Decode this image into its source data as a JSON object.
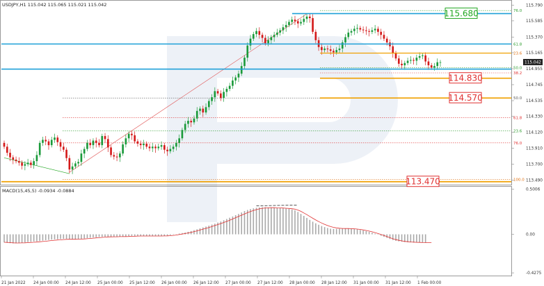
{
  "chart_data": [
    {
      "type": "candlestick",
      "header": "USDJPY,H1  115.042 115.065 115.021 115.042",
      "yticks": [
        "115.790",
        "115.585",
        "115.370",
        "115.165",
        "114.955",
        "114.745",
        "114.535",
        "114.330",
        "114.120",
        "113.910",
        "113.700",
        "113.490"
      ],
      "ytick_values": [
        115.79,
        115.585,
        115.37,
        115.165,
        114.955,
        114.745,
        114.535,
        114.33,
        114.12,
        113.91,
        113.7,
        113.49
      ],
      "ylim": [
        113.44,
        115.84
      ],
      "current_price": "115.042",
      "current_price_value": 115.042,
      "price_labels": [
        {
          "text": "115.680",
          "value": 115.68,
          "color": "#22a722"
        },
        {
          "text": "114.830",
          "value": 114.83,
          "color": "#e03030"
        },
        {
          "text": "114.570",
          "value": 114.57,
          "color": "#e03030"
        },
        {
          "text": "113.470",
          "value": 113.47,
          "color": "#e03030"
        }
      ],
      "fib_levels": [
        {
          "text": "76.0",
          "value": 115.72,
          "color": "#2d9c2d"
        },
        {
          "text": "61.8",
          "value": 115.28,
          "color": "#2d9c2d"
        },
        {
          "text": "23.6",
          "value": 115.16,
          "color": "#e07010"
        },
        {
          "text": "50.0",
          "value": 114.97,
          "color": "#2d9c2d"
        },
        {
          "text": "38.2",
          "value": 114.9,
          "color": "#e03030"
        },
        {
          "text": "50.0",
          "value": 114.57,
          "color": "#555555"
        },
        {
          "text": "61.8",
          "value": 114.31,
          "color": "#e03030"
        },
        {
          "text": "23.6",
          "value": 114.14,
          "color": "#2d9c2d"
        },
        {
          "text": "76.0",
          "value": 113.98,
          "color": "#e03030"
        },
        {
          "text": "100.0",
          "value": 113.5,
          "color": "#e07010"
        }
      ],
      "candles_close": [
        113.93,
        113.85,
        113.79,
        113.76,
        113.74,
        113.72,
        113.68,
        113.7,
        113.72,
        113.69,
        113.74,
        113.82,
        113.98,
        114.02,
        114.0,
        113.95,
        114.02,
        114.05,
        113.99,
        113.93,
        113.89,
        113.78,
        113.63,
        113.67,
        113.71,
        113.73,
        113.84,
        113.9,
        113.98,
        113.95,
        114.01,
        113.98,
        113.95,
        114.07,
        114.03,
        113.92,
        113.82,
        113.8,
        113.79,
        113.84,
        113.96,
        114.04,
        114.1,
        114.08,
        114.0,
        113.97,
        113.95,
        113.97,
        113.93,
        113.91,
        113.93,
        113.91,
        113.93,
        113.95,
        113.89,
        113.87,
        113.9,
        113.93,
        113.98,
        114.04,
        114.15,
        114.23,
        114.27,
        114.25,
        114.3,
        114.4,
        114.43,
        114.38,
        114.45,
        114.53,
        114.58,
        114.66,
        114.63,
        114.57,
        114.65,
        114.69,
        114.73,
        114.8,
        114.84,
        114.89,
        114.99,
        115.1,
        115.26,
        115.35,
        115.41,
        115.45,
        115.4,
        115.36,
        115.29,
        115.33,
        115.37,
        115.4,
        115.43,
        115.46,
        115.5,
        115.53,
        115.57,
        115.6,
        115.58,
        115.55,
        115.57,
        115.61,
        115.64,
        115.62,
        115.44,
        115.33,
        115.24,
        115.2,
        115.22,
        115.21,
        115.19,
        115.17,
        115.2,
        115.22,
        115.3,
        115.37,
        115.43,
        115.45,
        115.48,
        115.49,
        115.47,
        115.46,
        115.45,
        115.44,
        115.46,
        115.48,
        115.44,
        115.4,
        115.35,
        115.3,
        115.25,
        115.16,
        115.09,
        115.02,
        115.0,
        115.03,
        115.06,
        115.07,
        115.06,
        115.1,
        115.12,
        115.13,
        115.05,
        115.0,
        114.97,
        114.99,
        115.04,
        115.04
      ],
      "series": [
        {
          "name": "MACD(15,45,5) -0.0934",
          "values": [
            -0.09,
            -0.094,
            -0.098,
            -0.1,
            -0.1,
            -0.098,
            -0.094,
            -0.09,
            -0.086,
            -0.082,
            -0.08,
            -0.078,
            -0.074,
            -0.07,
            -0.066,
            -0.062,
            -0.058,
            -0.056,
            -0.054,
            -0.052,
            -0.05,
            -0.05,
            -0.052,
            -0.054,
            -0.054,
            -0.052,
            -0.05,
            -0.046,
            -0.042,
            -0.038,
            -0.035,
            -0.032,
            -0.03,
            -0.028,
            -0.026,
            -0.026,
            -0.026,
            -0.026,
            -0.026,
            -0.026,
            -0.024,
            -0.022,
            -0.02,
            -0.018,
            -0.018,
            -0.018,
            -0.018,
            -0.018,
            -0.018,
            -0.018,
            -0.018,
            -0.018,
            -0.018,
            -0.018,
            -0.016,
            -0.014,
            -0.01,
            -0.004,
            0.002,
            0.008,
            0.014,
            0.02,
            0.028,
            0.036,
            0.046,
            0.056,
            0.066,
            0.076,
            0.086,
            0.096,
            0.108,
            0.118,
            0.13,
            0.142,
            0.156,
            0.17,
            0.184,
            0.198,
            0.212,
            0.226,
            0.242,
            0.258,
            0.27,
            0.28,
            0.288,
            0.294,
            0.298,
            0.3,
            0.3,
            0.298,
            0.296,
            0.294,
            0.292,
            0.29,
            0.288,
            0.286,
            0.282,
            0.276,
            0.266,
            0.248,
            0.226,
            0.204,
            0.182,
            0.16,
            0.14,
            0.122,
            0.106,
            0.092,
            0.08,
            0.07,
            0.062,
            0.06,
            0.06,
            0.062,
            0.064,
            0.064,
            0.064,
            0.062,
            0.058,
            0.054,
            0.048,
            0.042,
            0.036,
            0.028,
            0.018,
            0.008,
            -0.004,
            -0.016,
            -0.028,
            -0.04,
            -0.052,
            -0.064,
            -0.072,
            -0.078,
            -0.082,
            -0.086,
            -0.088,
            -0.09,
            -0.092,
            -0.092,
            -0.092,
            -0.092,
            -0.093
          ]
        },
        {
          "name": "Signal -0.0884",
          "values": [
            -0.088,
            -0.09,
            -0.092,
            -0.094,
            -0.096,
            -0.096,
            -0.095,
            -0.094,
            -0.092,
            -0.09,
            -0.088,
            -0.086,
            -0.083,
            -0.08,
            -0.077,
            -0.073,
            -0.069,
            -0.066,
            -0.063,
            -0.061,
            -0.058,
            -0.056,
            -0.055,
            -0.055,
            -0.055,
            -0.054,
            -0.053,
            -0.051,
            -0.049,
            -0.046,
            -0.043,
            -0.04,
            -0.037,
            -0.034,
            -0.031,
            -0.029,
            -0.028,
            -0.027,
            -0.027,
            -0.026,
            -0.026,
            -0.025,
            -0.024,
            -0.022,
            -0.021,
            -0.02,
            -0.019,
            -0.019,
            -0.019,
            -0.019,
            -0.019,
            -0.019,
            -0.019,
            -0.019,
            -0.018,
            -0.017,
            -0.015,
            -0.012,
            -0.008,
            -0.003,
            0.003,
            0.009,
            0.015,
            0.022,
            0.03,
            0.038,
            0.047,
            0.057,
            0.066,
            0.076,
            0.086,
            0.097,
            0.108,
            0.119,
            0.131,
            0.143,
            0.156,
            0.17,
            0.184,
            0.198,
            0.212,
            0.226,
            0.24,
            0.253,
            0.264,
            0.274,
            0.282,
            0.288,
            0.292,
            0.294,
            0.295,
            0.295,
            0.294,
            0.293,
            0.291,
            0.289,
            0.287,
            0.284,
            0.279,
            0.269,
            0.255,
            0.237,
            0.218,
            0.198,
            0.178,
            0.159,
            0.141,
            0.125,
            0.11,
            0.097,
            0.086,
            0.077,
            0.071,
            0.067,
            0.065,
            0.064,
            0.064,
            0.063,
            0.061,
            0.058,
            0.054,
            0.049,
            0.043,
            0.036,
            0.028,
            0.019,
            0.009,
            -0.002,
            -0.013,
            -0.025,
            -0.037,
            -0.049,
            -0.059,
            -0.067,
            -0.073,
            -0.078,
            -0.082,
            -0.085,
            -0.087,
            -0.089,
            -0.09,
            -0.091,
            -0.092,
            -0.092,
            -0.092
          ]
        }
      ]
    },
    {
      "type": "bar",
      "header": "MACD(15,45,5) -0.0934 -0.0884",
      "yticks": [
        "0.5006",
        "0.00",
        "-0.4275"
      ],
      "ytick_values": [
        0.5006,
        0,
        -0.4275
      ],
      "ylim": [
        -0.45,
        0.52
      ],
      "categories": [
        "21 Jan 2022",
        "24 Jan 00:00",
        "24 Jan 12:00",
        "25 Jan 00:00",
        "25 Jan 12:00",
        "26 Jan 00:00",
        "26 Jan 12:00",
        "27 Jan 00:00",
        "27 Jan 12:00",
        "28 Jan 00:00",
        "28 Jan 12:00",
        "31 Jan 00:00",
        "31 Jan 12:00",
        "1 Feb 00:00"
      ]
    }
  ]
}
